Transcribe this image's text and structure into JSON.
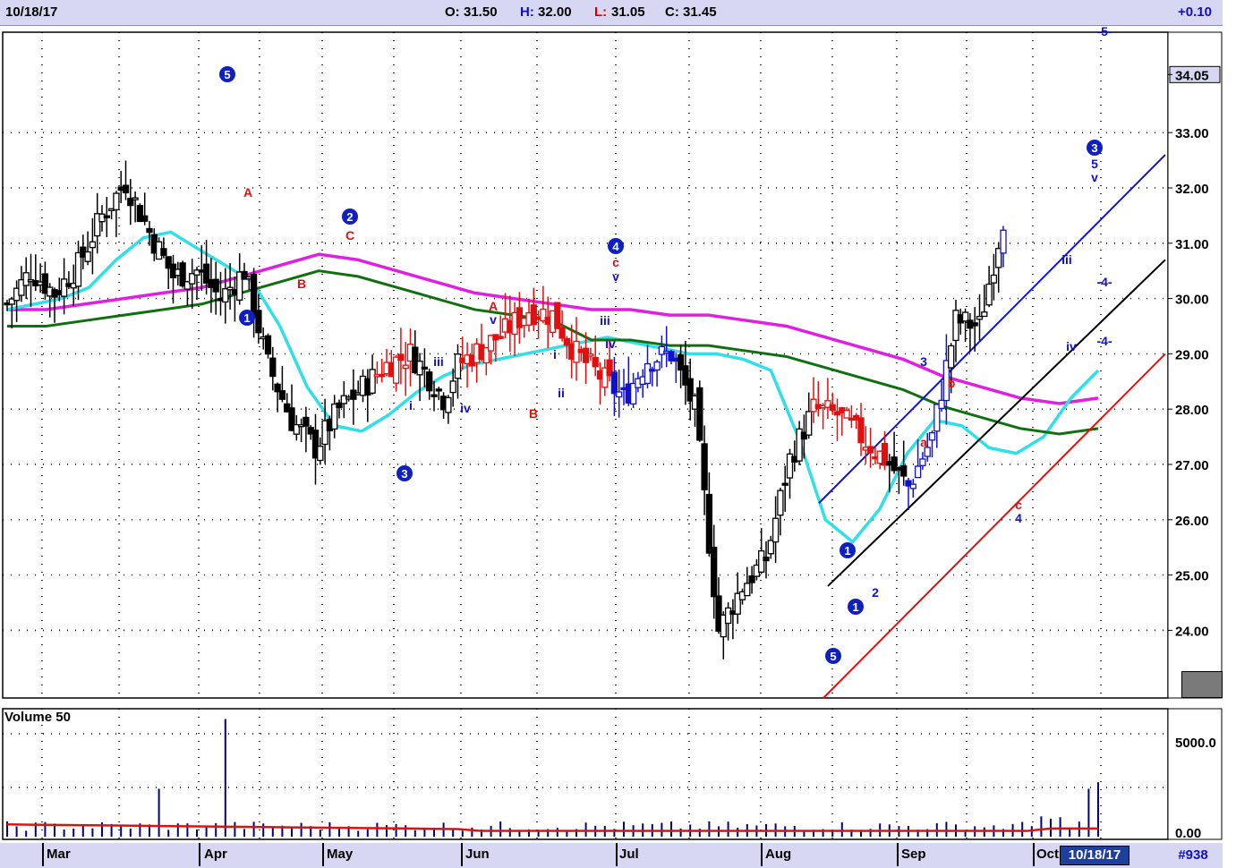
{
  "header": {
    "date": "10/18/17",
    "open_label": "O:",
    "open": "31.50",
    "high_label": "H:",
    "high": "32.00",
    "low_label": "L:",
    "low": "31.05",
    "close_label": "C:",
    "close": "31.45",
    "change": "+0.10"
  },
  "price_axis": {
    "ticks": [
      "34.05",
      "33.00",
      "32.00",
      "31.00",
      "30.00",
      "29.00",
      "28.00",
      "27.00",
      "26.00",
      "25.00",
      "24.00"
    ]
  },
  "volume_panel": {
    "label": "Volume 50",
    "ticks": [
      "5000.0",
      "0.00"
    ]
  },
  "x_axis": {
    "months": [
      "Mar",
      "Apr",
      "May",
      "Jun",
      "Jul",
      "Aug",
      "Sep",
      "Oct"
    ],
    "current_date": "10/18/17",
    "chart_id": "#938"
  },
  "wave_labels": {
    "circled": [
      "5",
      "1",
      "2",
      "3",
      "4",
      "5",
      "1",
      "2",
      "3"
    ],
    "letters": [
      "A",
      "B",
      "C",
      "A",
      "B",
      "c",
      "a",
      "b",
      "c"
    ],
    "minor": [
      "i",
      "iii",
      "iv",
      "v",
      "i",
      "ii",
      "iii",
      "iv",
      "v",
      "v",
      "iii",
      "iv",
      "v",
      "1",
      "2",
      "3",
      "4",
      "5",
      "-4-",
      "-4-",
      "-5-"
    ]
  },
  "chart_data": {
    "type": "candlestick",
    "title": "",
    "ylim": [
      23.3,
      35.5
    ],
    "colors": {
      "up": "#1010d0",
      "down": "#000000",
      "correction": "#e01010",
      "ma_fast": "#30e0e8",
      "ma_mid": "#107010",
      "ma_slow": "#e020e0",
      "volume_ma": "#e01010",
      "volume": "#000080"
    },
    "series": [
      {
        "name": "price_path",
        "x_days": [
          0,
          5,
          10,
          15,
          20,
          25,
          30,
          35,
          40,
          45,
          50,
          55,
          60,
          65,
          70,
          75,
          80,
          85,
          88,
          92,
          95,
          100,
          105,
          110,
          115,
          120,
          125,
          130,
          135,
          140,
          145,
          150,
          155,
          160,
          165,
          170,
          175,
          180,
          185,
          190,
          195,
          200,
          205,
          210,
          215,
          220,
          225,
          230
        ],
        "close": [
          29.9,
          30.5,
          30.1,
          30.6,
          31.5,
          32.1,
          31.2,
          30.4,
          30.5,
          30.0,
          30.5,
          28.8,
          27.8,
          27.3,
          28.0,
          28.4,
          28.8,
          29.0,
          28.7,
          28.2,
          28.8,
          29.1,
          29.4,
          29.8,
          29.7,
          29.0,
          28.6,
          28.2,
          28.9,
          29.0,
          28.0,
          24.0,
          24.8,
          25.3,
          27.1,
          28.0,
          27.9,
          27.5,
          27.1,
          26.6,
          27.5,
          29.6,
          29.5,
          31.45
        ]
      },
      {
        "name": "ma_fast_path",
        "values": [
          29.8,
          29.9,
          30.0,
          30.2,
          30.7,
          31.1,
          31.2,
          30.9,
          30.6,
          30.3,
          29.5,
          28.4,
          27.7,
          27.6,
          27.9,
          28.3,
          28.6,
          28.8,
          28.9,
          29.0,
          29.1,
          29.2,
          29.3,
          29.2,
          29.1,
          29.0,
          29.0,
          28.9,
          28.7,
          27.5,
          26.0,
          25.6,
          26.2,
          27.2,
          27.8,
          27.7,
          27.3,
          27.2,
          27.5,
          28.2,
          28.7
        ]
      },
      {
        "name": "ma_slow_path",
        "values": [
          29.8,
          29.8,
          29.9,
          30.0,
          30.1,
          30.2,
          30.4,
          30.6,
          30.8,
          30.7,
          30.5,
          30.3,
          30.1,
          30.0,
          29.9,
          29.8,
          29.8,
          29.7,
          29.7,
          29.6,
          29.5,
          29.3,
          29.1,
          28.9,
          28.6,
          28.4,
          28.2,
          28.1,
          28.2
        ]
      }
    ],
    "volume_ylim": [
      0,
      7500
    ],
    "volume_baseline": 300,
    "volume_spikes": [
      {
        "label": "Mar",
        "value": 1300
      },
      {
        "label": "Apr",
        "value": 7200
      },
      {
        "label": "Oct",
        "value": 2100
      }
    ]
  }
}
